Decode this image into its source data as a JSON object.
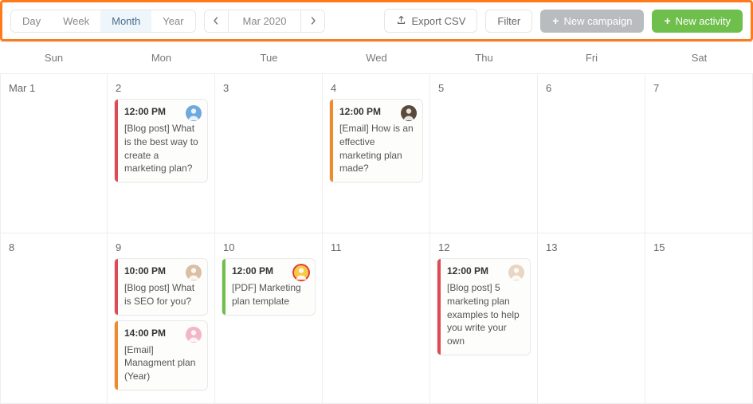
{
  "toolbar": {
    "views": {
      "day": "Day",
      "week": "Week",
      "month": "Month",
      "year": "Year",
      "active": "month"
    },
    "month_label": "Mar 2020",
    "export": "Export CSV",
    "filter": "Filter",
    "new_campaign": "New campaign",
    "new_activity": "New activity"
  },
  "dow": [
    "Sun",
    "Mon",
    "Tue",
    "Wed",
    "Thu",
    "Fri",
    "Sat"
  ],
  "weeks": [
    {
      "days": [
        {
          "num": "Mar 1"
        },
        {
          "num": "2",
          "cards": [
            {
              "accent": "red",
              "time": "12:00 PM",
              "title": "[Blog post] What is the best way to create a marketing plan?",
              "avatar": "blue"
            }
          ]
        },
        {
          "num": "3"
        },
        {
          "num": "4",
          "cards": [
            {
              "accent": "orange",
              "time": "12:00 PM",
              "title": "[Email] How is an effective marketing plan made?",
              "avatar": "dark"
            }
          ]
        },
        {
          "num": "5"
        },
        {
          "num": "6"
        },
        {
          "num": "7"
        }
      ]
    },
    {
      "days": [
        {
          "num": "8"
        },
        {
          "num": "9",
          "cards": [
            {
              "accent": "red",
              "time": "10:00 PM",
              "title": "[Blog post] What is SEO for you?",
              "avatar": "tan"
            },
            {
              "accent": "orange",
              "time": "14:00 PM",
              "title": "[Email] Managment plan (Year)",
              "avatar": "pink"
            }
          ]
        },
        {
          "num": "10",
          "cards": [
            {
              "accent": "green",
              "time": "12:00 PM",
              "title": "[PDF] Marketing plan template",
              "avatar": "ring"
            }
          ]
        },
        {
          "num": "11"
        },
        {
          "num": "12",
          "cards": [
            {
              "accent": "red",
              "time": "12:00 PM",
              "title": "[Blog post] 5 marketing plan examples to help you write your own",
              "avatar": "light"
            }
          ]
        },
        {
          "num": "13"
        },
        {
          "num": "15"
        }
      ]
    }
  ]
}
